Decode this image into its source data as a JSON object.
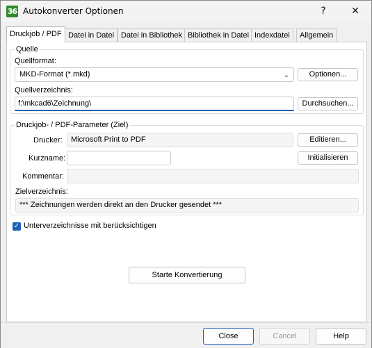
{
  "window": {
    "title": "Autokonverter Optionen",
    "icon_text": "36",
    "help_glyph": "?",
    "close_glyph": "✕"
  },
  "tabs": [
    {
      "label": "Druckjob / PDF",
      "active": true
    },
    {
      "label": "Datei in Datei"
    },
    {
      "label": "Datei in Bibliothek"
    },
    {
      "label": "Bibliothek in Datei"
    },
    {
      "label": "Indexdatei"
    },
    {
      "label": "Allgemein"
    }
  ],
  "quelle": {
    "group_label": "Quelle",
    "format_label": "Quellformat:",
    "format_value": "MKD-Format (*.mkd)",
    "options_button": "Optionen...",
    "dir_label": "Quellverzeichnis:",
    "dir_value": "f:\\mkcad6\\Zeichnung\\",
    "browse_button": "Durchsuchen..."
  },
  "druckjob": {
    "group_label": "Druckjob- / PDF-Parameter (Ziel)",
    "printer_label": "Drucker:",
    "printer_value": "Microsoft Print to PDF",
    "edit_button": "Editieren...",
    "shortname_label": "Kurzname:",
    "shortname_value": "",
    "init_button": "Initialisieren",
    "comment_label": "Kommentar:",
    "comment_value": "",
    "target_label": "Zielverzeichnis:",
    "target_value": "*** Zeichnungen werden direkt an den Drucker gesendet ***"
  },
  "subdirs": {
    "checked": true,
    "label": "Unterverzeichnisse mit berücksichtigen"
  },
  "start_button": "Starte Konvertierung",
  "footer": {
    "close": "Close",
    "cancel": "Cancel",
    "help": "Help"
  }
}
